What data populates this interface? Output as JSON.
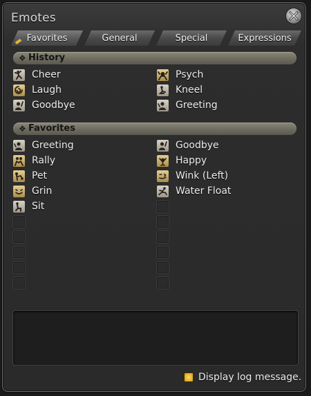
{
  "window": {
    "title": "Emotes"
  },
  "tabs": [
    {
      "label": "Favorites",
      "active": true
    },
    {
      "label": "General",
      "active": false
    },
    {
      "label": "Special",
      "active": false
    },
    {
      "label": "Expressions",
      "active": false
    }
  ],
  "history": {
    "header": "History",
    "left": [
      {
        "label": "Cheer",
        "icon": "cheer-icon"
      },
      {
        "label": "Laugh",
        "icon": "laugh-icon"
      },
      {
        "label": "Goodbye",
        "icon": "goodbye-icon"
      }
    ],
    "right": [
      {
        "label": "Psych",
        "icon": "psych-icon"
      },
      {
        "label": "Kneel",
        "icon": "kneel-icon"
      },
      {
        "label": "Greeting",
        "icon": "greeting-icon"
      }
    ]
  },
  "favorites": {
    "header": "Favorites",
    "left": [
      {
        "label": "Greeting",
        "icon": "greeting-icon"
      },
      {
        "label": "Rally",
        "icon": "rally-icon"
      },
      {
        "label": "Pet",
        "icon": "pet-icon"
      },
      {
        "label": "Grin",
        "icon": "grin-icon"
      },
      {
        "label": "Sit",
        "icon": "sit-icon"
      }
    ],
    "right": [
      {
        "label": "Goodbye",
        "icon": "goodbye-icon"
      },
      {
        "label": "Happy",
        "icon": "happy-icon"
      },
      {
        "label": "Wink (Left)",
        "icon": "wink-icon"
      },
      {
        "label": "Water Float",
        "icon": "water-float-icon"
      }
    ]
  },
  "footer": {
    "display_log_label": "Display log message.",
    "display_log_checked": true
  }
}
